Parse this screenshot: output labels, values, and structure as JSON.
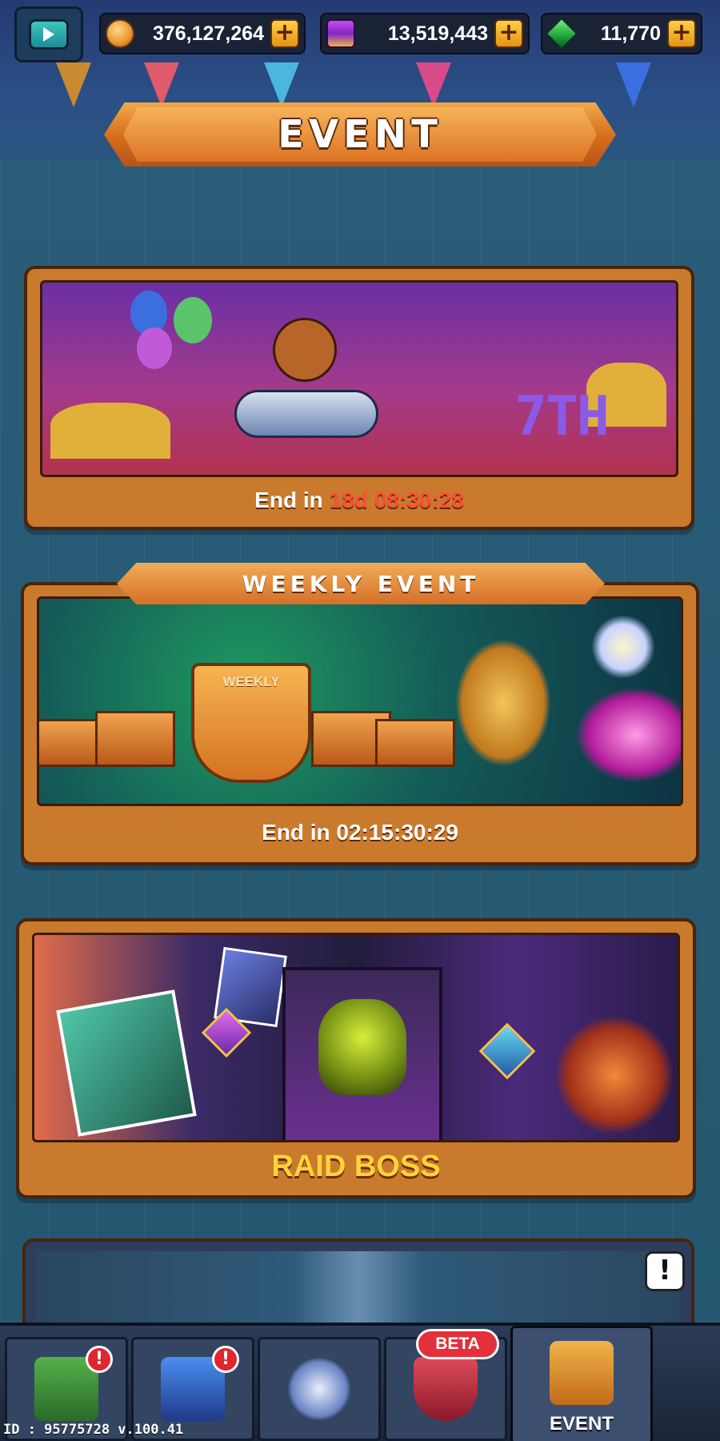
{
  "topbar": {
    "coins": "376,127,264",
    "crystals": "13,519,443",
    "gems": "11,770",
    "icons": {
      "video": "tv-play-icon",
      "coin": "gold-coin-icon",
      "crystal": "purple-crystal-icon",
      "gem": "green-gem-icon",
      "plus": "plus-icon"
    }
  },
  "header": {
    "title": "EVENT"
  },
  "events": [
    {
      "name": "anniversary-7th",
      "badge_text": "7TH",
      "end_prefix": "End in",
      "end_time": "18d 08:30:28",
      "end_time_color": "#ff4f3a"
    },
    {
      "ribbon": "WEEKLY EVENT",
      "trophy_label": "WEEKLY",
      "end_text": "End in 02:15:30:29"
    },
    {
      "title": "RAID BOSS"
    },
    {
      "alert": "!"
    }
  ],
  "nav": {
    "items": [
      {
        "icon": "shop-chest-icon",
        "notification": "!"
      },
      {
        "icon": "robot-pet-icon",
        "notification": "!"
      },
      {
        "icon": "spaceship-icon"
      },
      {
        "icon": "shield-wings-icon",
        "badge": "BETA"
      },
      {
        "icon": "event-trophy-icon",
        "label": "EVENT",
        "active": true
      }
    ]
  },
  "footer": {
    "build": "ID : 95775728  v.100.41"
  }
}
